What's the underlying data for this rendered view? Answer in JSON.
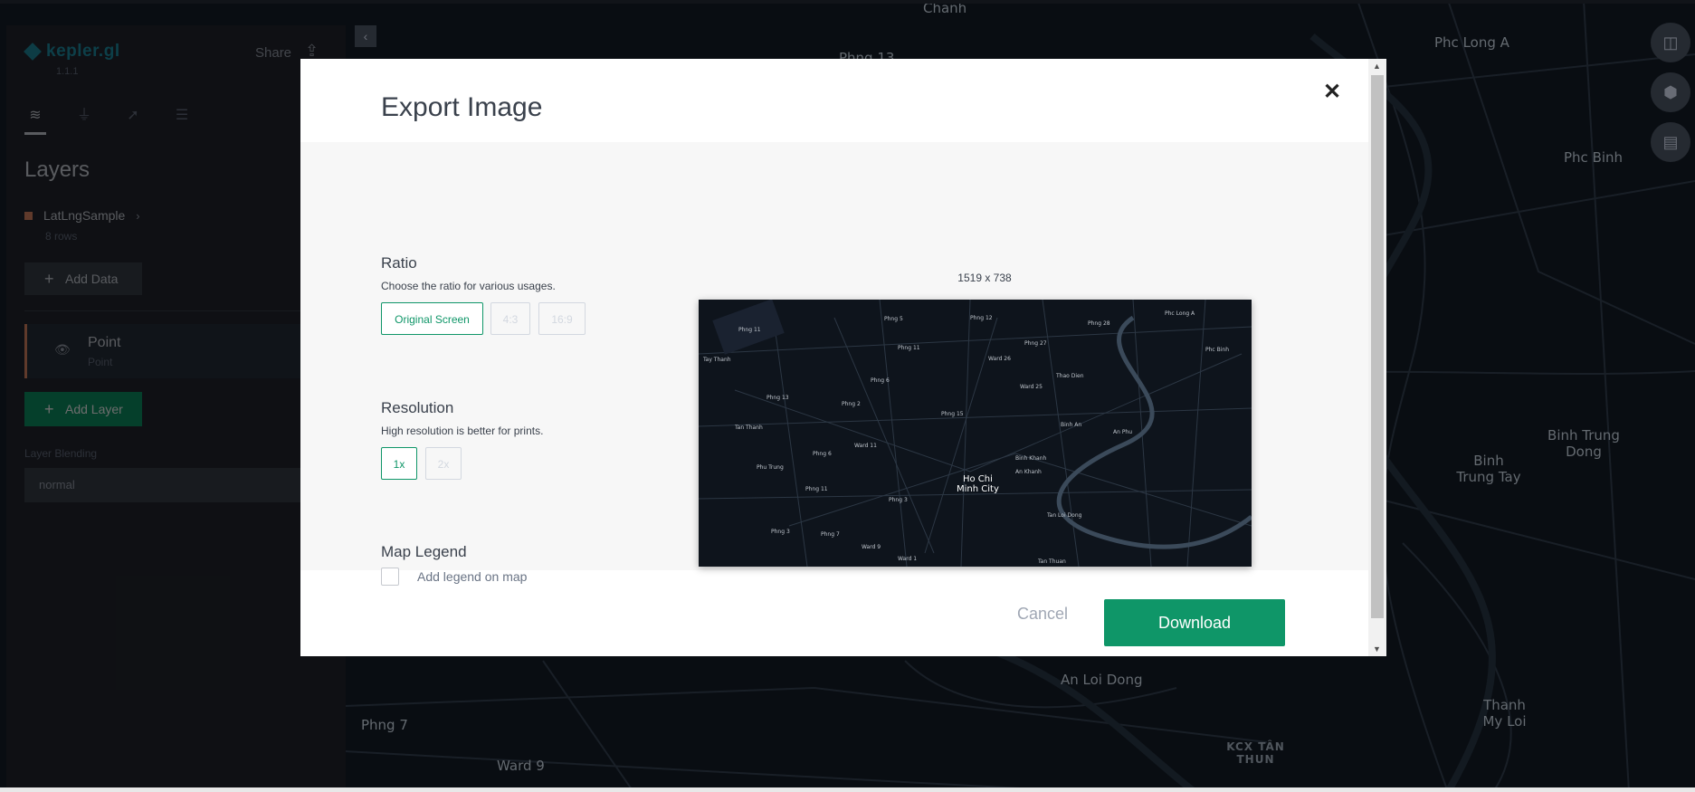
{
  "map": {
    "labels": [
      {
        "id": "chanh",
        "text": "Chanh"
      },
      {
        "id": "phc-long-a",
        "text": "Phc Long A"
      },
      {
        "id": "phc-binh",
        "text": "Phc Binh"
      },
      {
        "id": "binh-trung-dong",
        "text": "Binh Trung\nDong"
      },
      {
        "id": "binh-trung-tay",
        "text": "Binh\nTrung Tay"
      },
      {
        "id": "an-loi-dong",
        "text": "An Loi Dong"
      },
      {
        "id": "thanh-my-loi",
        "text": "Thanh\nMy Loi"
      },
      {
        "id": "kcx-tan-thun",
        "text": "KCX TÂN\nTHUN"
      },
      {
        "id": "phng-7",
        "text": "Phng 7"
      },
      {
        "id": "ward-9",
        "text": "Ward 9"
      },
      {
        "id": "phng-13",
        "text": "Phng 13"
      }
    ]
  },
  "sidebar": {
    "app_name": "kepler.gl",
    "version": "1.1.1",
    "share_label": "Share",
    "layers_title": "Layers",
    "dataset_name": "LatLngSample",
    "dataset_rows": "8 rows",
    "add_data_label": "Add Data",
    "layer": {
      "name": "Point",
      "type": "Point"
    },
    "add_layer_label": "Add Layer",
    "blending_label": "Layer Blending",
    "blending_value": "normal"
  },
  "modal": {
    "title": "Export Image",
    "ratio": {
      "title": "Ratio",
      "description": "Choose the ratio for various usages.",
      "options": [
        "Original Screen",
        "4:3",
        "16:9"
      ],
      "selected": "Original Screen"
    },
    "resolution": {
      "title": "Resolution",
      "description": "High resolution is better for prints.",
      "options": [
        "1x",
        "2x"
      ],
      "selected": "1x"
    },
    "legend": {
      "title": "Map Legend",
      "checkbox_label": "Add legend on map",
      "checked": false
    },
    "preview_dimensions": "1519 x 738",
    "preview_center_label": "Ho Chi\nMinh City",
    "cancel_label": "Cancel",
    "download_label": "Download"
  },
  "colors": {
    "accent": "#0f9668",
    "panel": "#242730",
    "map_bg": "#0e141c",
    "layer_color": "#e38a66"
  }
}
